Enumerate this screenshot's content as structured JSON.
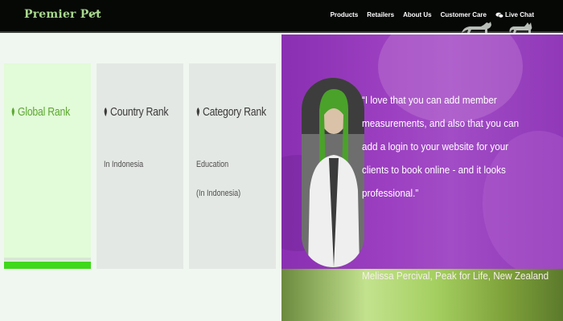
{
  "header": {
    "brand": "Premier Pet",
    "nav": [
      {
        "label": "Products"
      },
      {
        "label": "Retailers"
      },
      {
        "label": "About Us"
      },
      {
        "label": "Customer Care"
      },
      {
        "label": "Live Chat",
        "icon": "chat-bubbles-icon"
      }
    ]
  },
  "stats": {
    "cards": [
      {
        "title": "Global Rank",
        "icon": "leaf-icon",
        "lines": [],
        "active": true
      },
      {
        "title": "Country Rank",
        "icon": "leaf-icon",
        "lines": [
          "In Indonesia"
        ],
        "active": false
      },
      {
        "title": "Category Rank",
        "icon": "leaf-icon",
        "lines": [
          "Education",
          "(In Indonesia)"
        ],
        "active": false
      }
    ]
  },
  "testimonial": {
    "quote": "“I love that you can add member measurements, and also that you can add a login to your website for your clients to book online - and it looks professional.”",
    "author": "Melissa Percival, Peak for Life, New Zealand"
  },
  "colors": {
    "brand": "#a9d88f",
    "active_accent": "#3fd81b",
    "testimonial_bg": "#9b3ec0",
    "nav_bg": "#060806"
  }
}
